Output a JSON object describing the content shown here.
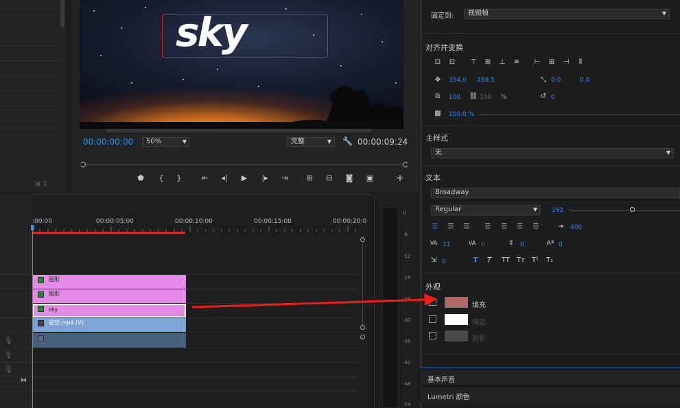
{
  "monitor": {
    "title_text": "sky",
    "current_time": "00:00:00:00",
    "zoom": "50%",
    "quality": "完整",
    "duration": "00:00:09:24"
  },
  "timeline": {
    "timecodes": [
      ":00:00",
      "00:00:05:00",
      "00:00:10:00",
      "00:00:15:00",
      "00:00:20:0"
    ],
    "clips": [
      {
        "label": "图形",
        "kind": "pink"
      },
      {
        "label": "图形",
        "kind": "pink"
      },
      {
        "label": "sky",
        "kind": "pink-selected"
      },
      {
        "label": "星空.mp4 [V]",
        "kind": "blue"
      }
    ]
  },
  "meter": {
    "db_labels": [
      "0",
      "-6",
      "-12",
      "-18",
      "-24",
      "-30",
      "-36",
      "-42",
      "-48",
      "-54"
    ]
  },
  "properties": {
    "pin_label": "固定到:",
    "pin_value": "视频帧",
    "align_title": "对齐并变换",
    "position_x": "354.0",
    "position_y": "288.5",
    "anchor_x": "0.0",
    "anchor_y": "0.0",
    "scale_w": "100",
    "scale_h": "100",
    "scale_unit": "%",
    "rotation": "0",
    "opacity": "100.0 %",
    "master_style_title": "主样式",
    "master_style_value": "无",
    "text_title": "文本",
    "font_family": "Broadway",
    "font_style": "Regular",
    "font_size": "192",
    "tab_width": "400",
    "tracking": "11",
    "kerning": "0",
    "leading": "0",
    "baseline": "0",
    "tsume": "0",
    "appearance_title": "外观",
    "fill_label": "填充",
    "stroke_label": "描边",
    "shadow_label": "阴影",
    "colors": {
      "fill": "#b46664",
      "stroke": "#ffffff",
      "shadow": "#4a4a4a"
    },
    "fill_checked": true,
    "stroke_checked": false,
    "shadow_checked": false
  },
  "bottom_panels": [
    "基本声音",
    "Lumetri 颜色"
  ]
}
